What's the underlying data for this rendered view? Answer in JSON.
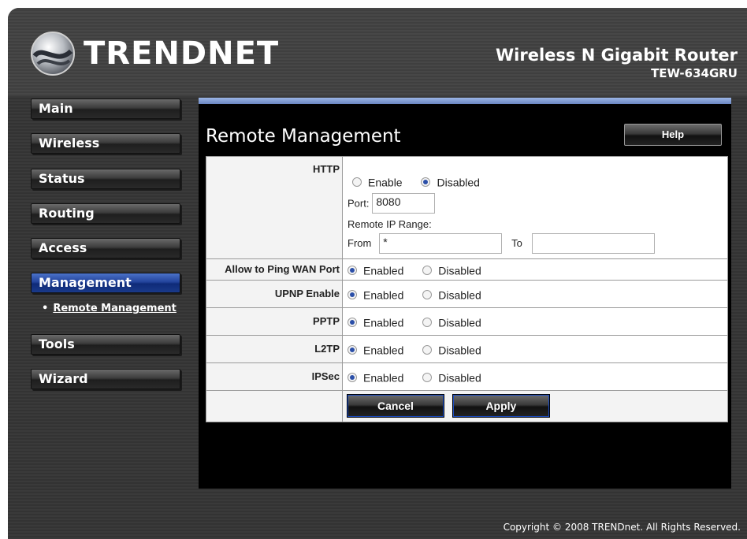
{
  "header": {
    "brand": "TRENDNET",
    "product": "Wireless N Gigabit Router",
    "model": "TEW-634GRU"
  },
  "nav": {
    "items": [
      {
        "label": "Main"
      },
      {
        "label": "Wireless"
      },
      {
        "label": "Status"
      },
      {
        "label": "Routing"
      },
      {
        "label": "Access"
      },
      {
        "label": "Management"
      },
      {
        "label": "Tools"
      },
      {
        "label": "Wizard"
      }
    ],
    "active": "Management",
    "sub_item": "Remote Management"
  },
  "page": {
    "title": "Remote Management",
    "help": "Help"
  },
  "form": {
    "http": {
      "label": "HTTP",
      "enable": "Enable",
      "disabled": "Disabled",
      "selected": "Disabled",
      "port_label": "Port:",
      "port_value": "8080",
      "range_label": "Remote IP Range:",
      "from_label": "From",
      "from_value": "*",
      "to_label": "To",
      "to_value": ""
    },
    "ping": {
      "label": "Allow to Ping WAN Port",
      "enabled": "Enabled",
      "disabled": "Disabled",
      "selected": "Enabled"
    },
    "upnp": {
      "label": "UPNP Enable",
      "enabled": "Enabled",
      "disabled": "Disabled",
      "selected": "Enabled"
    },
    "pptp": {
      "label": "PPTP",
      "enabled": "Enabled",
      "disabled": "Disabled",
      "selected": "Enabled"
    },
    "l2tp": {
      "label": "L2TP",
      "enabled": "Enabled",
      "disabled": "Disabled",
      "selected": "Enabled"
    },
    "ipsec": {
      "label": "IPSec",
      "enabled": "Enabled",
      "disabled": "Disabled",
      "selected": "Enabled"
    },
    "cancel": "Cancel",
    "apply": "Apply"
  },
  "footer": {
    "copyright": "Copyright © 2008 TRENDnet. All Rights Reserved."
  },
  "colors": {
    "accent_blue": "#23449c",
    "panel": "#000000",
    "frame": "#3a3a3a"
  },
  "icons": {
    "logo": "trendnet-globe-icon"
  }
}
